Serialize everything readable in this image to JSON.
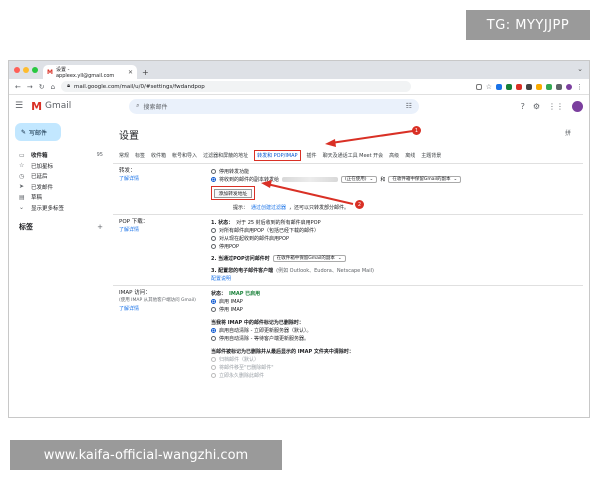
{
  "watermarks": {
    "top": "TG: MYYJJPP",
    "bottom": "www.kaifa-official-wangzhi.com"
  },
  "browser": {
    "tab_title": "设置 - appleex.yll@gmail.com",
    "url": "mail.google.com/mail/u/0/#settings/fwdandpop"
  },
  "gmail": {
    "logo_text": "Gmail",
    "search_placeholder": "搜索邮件",
    "compose_label": "写邮件",
    "nav": [
      {
        "icon": "inbox-icon",
        "glyph": "▭",
        "label": "收件箱",
        "count": "95"
      },
      {
        "icon": "star-icon",
        "glyph": "☆",
        "label": "已加星标",
        "count": ""
      },
      {
        "icon": "clock-icon",
        "glyph": "◷",
        "label": "已延后",
        "count": ""
      },
      {
        "icon": "send-icon",
        "glyph": "➤",
        "label": "已发邮件",
        "count": ""
      },
      {
        "icon": "draft-icon",
        "glyph": "▤",
        "label": "草稿",
        "count": ""
      },
      {
        "icon": "chevron-down-icon",
        "glyph": "⌄",
        "label": "显示更多标签",
        "count": ""
      }
    ],
    "labels_heading": "标签"
  },
  "settings": {
    "title": "设置",
    "lang_indicator": "拼",
    "tabs": [
      "常规",
      "标签",
      "收件箱",
      "帐号和导入",
      "过滤器和屏蔽的地址",
      "转发和 POP/IMAP",
      "插件",
      "聊天及通话工具 Meet 开会",
      "高级",
      "离线",
      "主题背景"
    ],
    "active_tab": "转发和 POP/IMAP",
    "forwarding": {
      "label": "转发：",
      "learn_more": "了解详情",
      "opt_disable": "停用转发功能",
      "opt_enable": "将收到的邮件的副本转发给",
      "status_select": "(正在使用)",
      "and_text": "和",
      "keep_select": "在收件箱中保留Gmail的副本",
      "add_button": "添加转发地址",
      "tip_prefix": "提示：",
      "tip_link": "通过创建过滤器",
      "tip_suffix": "，还可以只转发部分邮件。"
    },
    "pop": {
      "label": "POP 下载：",
      "learn_more": "了解详情",
      "status_heading": "1. 状态：",
      "status_text": "对于 25 封后收到的所有邮件启用POP",
      "opt1": "对所有邮件启用POP（包括已经下载的邮件）",
      "opt2": "对从现在起收到的邮件启用POP",
      "opt3": "停用POP",
      "step2": "2. 当通过POP访问邮件时",
      "step2_select": "在收件箱中保留Gmail的副本",
      "step3": "3. 配置您的电子邮件客户端",
      "step3_hint": "(例如 Outlook、Eudora、Netscape Mail)",
      "config_link": "配置说明"
    },
    "imap": {
      "label": "IMAP 访问：",
      "sub": "(使用 IMAP 从其他客户端访问 Gmail)",
      "learn_more": "了解详情",
      "status_prefix": "状态：",
      "status_value": "IMAP 已启用",
      "opt_enable": "启用 IMAP",
      "opt_disable": "停用 IMAP",
      "deleted_heading": "当我将 IMAP 中的邮件标记为已删除时：",
      "deleted_opt1": "启用自动清除 - 立即更新服务器（默认）。",
      "deleted_opt2": "停用自动清除 - 等待客户端更新服务器。",
      "expunge_heading": "当邮件被标记为已删除并从最后显示的 IMAP 文件夹中清除时：",
      "expunge_opt1": "归档邮件（默认）",
      "expunge_opt2": "将邮件移至\"已删除邮件\"",
      "expunge_opt3": "立即永久删除此邮件"
    }
  },
  "annotations": {
    "badge1": "1",
    "badge2": "2"
  },
  "colors": {
    "accent_red": "#d93025",
    "gmail_blue": "#0b57d0",
    "link": "#1a73e8"
  }
}
